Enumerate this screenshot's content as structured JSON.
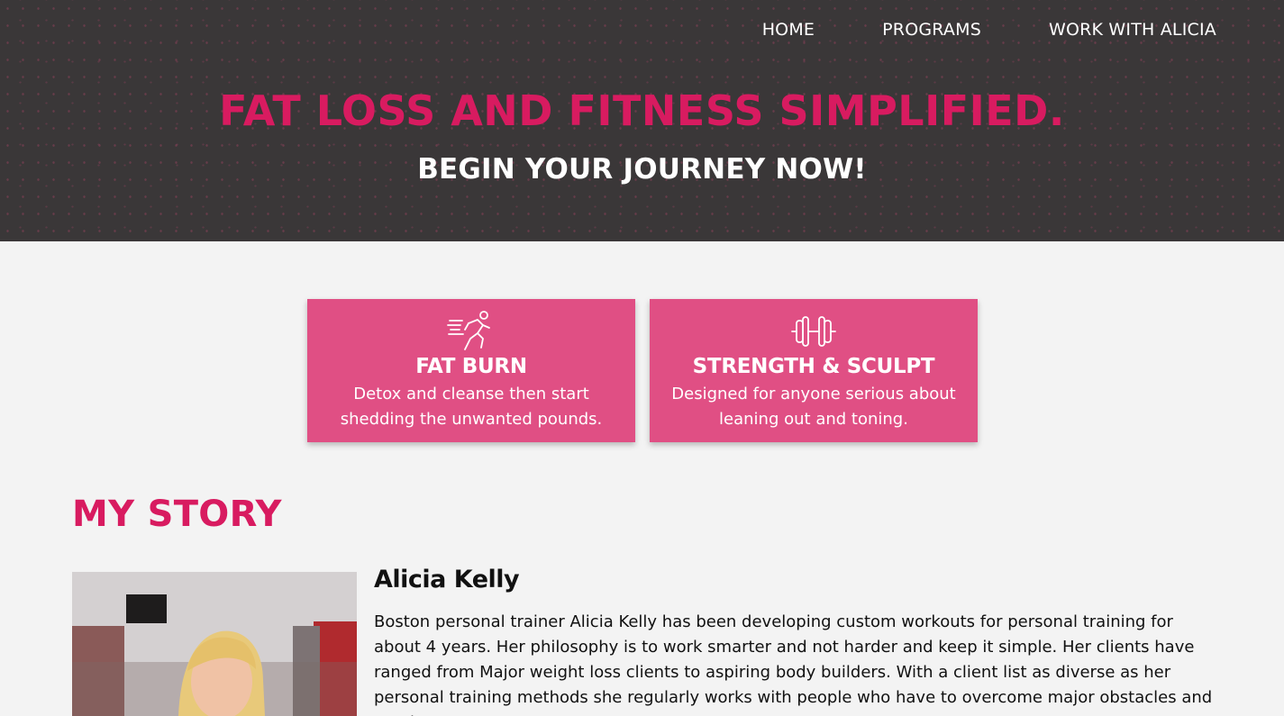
{
  "nav": {
    "items": [
      {
        "label": "HOME"
      },
      {
        "label": "PROGRAMS"
      },
      {
        "label": "WORK WITH ALICIA"
      }
    ]
  },
  "hero": {
    "title": "FAT LOSS AND FITNESS SIMPLIFIED.",
    "subtitle": "BEGIN YOUR JOURNEY NOW!"
  },
  "programs": [
    {
      "icon": "running-man-icon",
      "title": "FAT BURN",
      "description": "Detox and cleanse then start shedding the unwanted pounds."
    },
    {
      "icon": "dumbbell-icon",
      "title": "STRENGTH & SCULPT",
      "description": "Designed for anyone serious about leaning out and toning."
    }
  ],
  "story": {
    "heading": "MY STORY",
    "name": "Alicia Kelly",
    "bio": "Boston personal trainer Alicia Kelly has been developing custom workouts for personal training for about 4 years. Her philosophy is to work smarter and not harder and keep it simple. Her clients have ranged from Major weight loss clients to aspiring body builders. With a client list as diverse as her personal training methods she regularly works with people who have to overcome major obstacles and need extra"
  },
  "colors": {
    "accent": "#d81b60",
    "card": "#e04f84",
    "hero_bg": "#3a3738",
    "page_bg": "#f3f3f3"
  }
}
